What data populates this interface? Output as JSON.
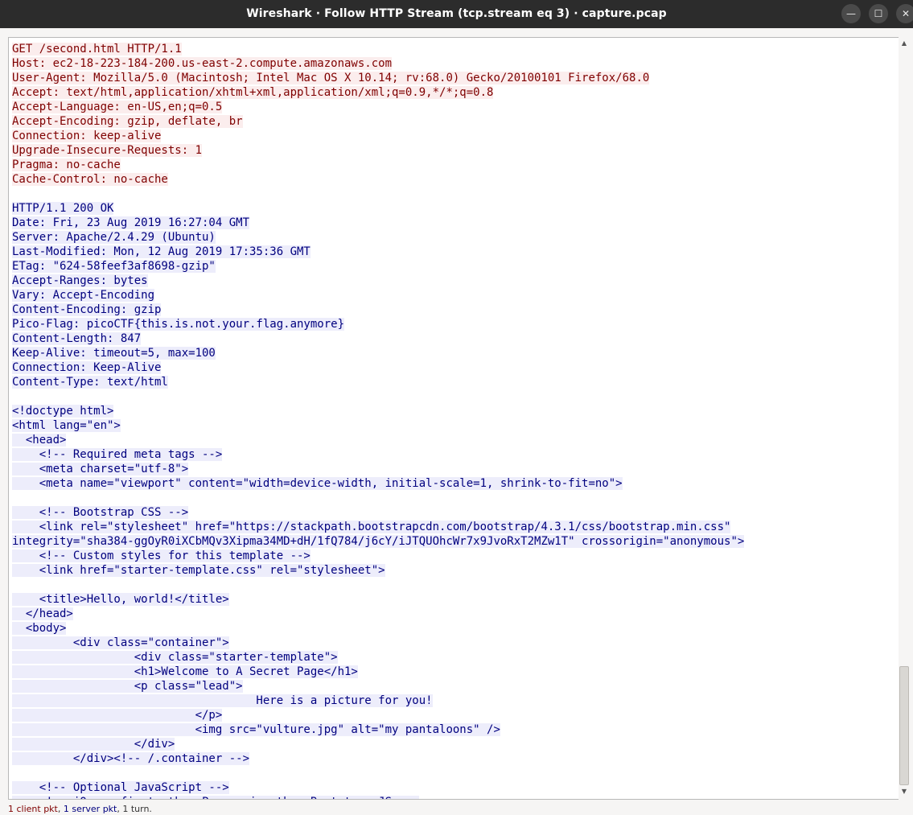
{
  "window": {
    "title": "Wireshark · Follow HTTP Stream (tcp.stream eq 3) · capture.pcap",
    "minimize_glyph": "—",
    "maximize_glyph": "☐",
    "close_glyph": "✕"
  },
  "colors": {
    "client_text": "#7f0000",
    "client_bg": "#fbeded",
    "server_text": "#00007f",
    "server_bg": "#ededfb"
  },
  "stream": {
    "request": [
      "GET /second.html HTTP/1.1",
      "Host: ec2-18-223-184-200.us-east-2.compute.amazonaws.com",
      "User-Agent: Mozilla/5.0 (Macintosh; Intel Mac OS X 10.14; rv:68.0) Gecko/20100101 Firefox/68.0",
      "Accept: text/html,application/xhtml+xml,application/xml;q=0.9,*/*;q=0.8",
      "Accept-Language: en-US,en;q=0.5",
      "Accept-Encoding: gzip, deflate, br",
      "Connection: keep-alive",
      "Upgrade-Insecure-Requests: 1",
      "Pragma: no-cache",
      "Cache-Control: no-cache"
    ],
    "response": [
      "HTTP/1.1 200 OK",
      "Date: Fri, 23 Aug 2019 16:27:04 GMT",
      "Server: Apache/2.4.29 (Ubuntu)",
      "Last-Modified: Mon, 12 Aug 2019 17:35:36 GMT",
      "ETag: \"624-58feef3af8698-gzip\"",
      "Accept-Ranges: bytes",
      "Vary: Accept-Encoding",
      "Content-Encoding: gzip",
      "Pico-Flag: picoCTF{this.is.not.your.flag.anymore}",
      "Content-Length: 847",
      "Keep-Alive: timeout=5, max=100",
      "Connection: Keep-Alive",
      "Content-Type: text/html",
      "",
      "<!doctype html>",
      "<html lang=\"en\">",
      "  <head>",
      "    <!-- Required meta tags -->",
      "    <meta charset=\"utf-8\">",
      "    <meta name=\"viewport\" content=\"width=device-width, initial-scale=1, shrink-to-fit=no\">",
      "",
      "    <!-- Bootstrap CSS -->",
      "    <link rel=\"stylesheet\" href=\"https://stackpath.bootstrapcdn.com/bootstrap/4.3.1/css/bootstrap.min.css\"",
      "integrity=\"sha384-ggOyR0iXCbMQv3Xipma34MD+dH/1fQ784/j6cY/iJTQUOhcWr7x9JvoRxT2MZw1T\" crossorigin=\"anonymous\">",
      "    <!-- Custom styles for this template -->",
      "    <link href=\"starter-template.css\" rel=\"stylesheet\">",
      "",
      "    <title>Hello, world!</title>",
      "  </head>",
      "  <body>",
      "         <div class=\"container\">",
      "                  <div class=\"starter-template\">",
      "                  <h1>Welcome to A Secret Page</h1>",
      "                  <p class=\"lead\">",
      "                                    Here is a picture for you!",
      "                           </p>",
      "                           <img src=\"vulture.jpg\" alt=\"my pantaloons\" />",
      "                  </div>",
      "         </div><!-- /.container -->",
      "",
      "    <!-- Optional JavaScript -->",
      "    <!-- jQuery first, then Popper.js, then Bootstrap JS -->"
    ]
  },
  "status": {
    "client_part": "1 client pkt",
    "separator": ", ",
    "server_part": "1 server pkt",
    "turns": ", 1 turn."
  }
}
